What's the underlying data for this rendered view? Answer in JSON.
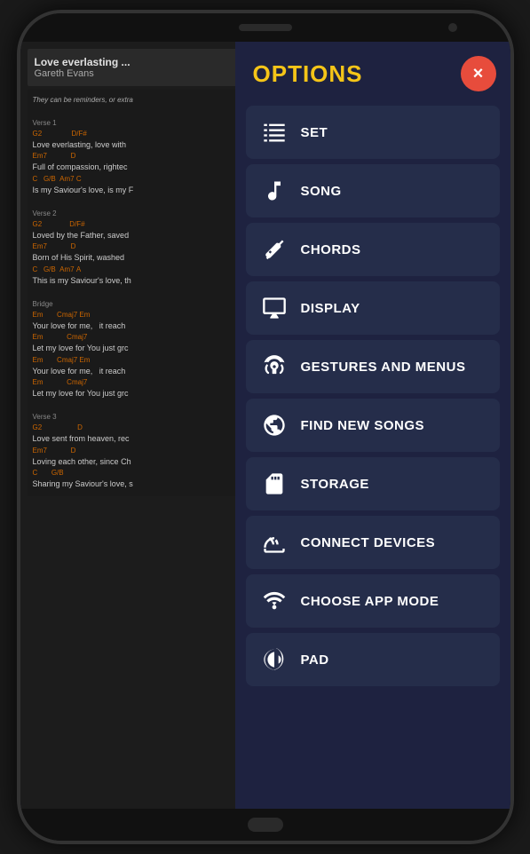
{
  "phone": {
    "screen": {
      "song": {
        "title": "Love everlasting ...",
        "artist": "Gareth Evans",
        "note": "They can be reminders, or extra",
        "sections": [
          {
            "label": "Verse 1",
            "lines": [
              {
                "chords": "G2                D/F#",
                "text": "Love everlasting, love with"
              },
              {
                "chords": "Em7               D",
                "text": "Full of compassion, rightec"
              },
              {
                "chords": "C    G/B    Am7  C",
                "text": "Is my Saviour's love, is my F"
              }
            ]
          },
          {
            "label": "Verse 2",
            "lines": [
              {
                "chords": "G2                D/F#",
                "text": "Loved by the Father, saved"
              },
              {
                "chords": "Em7               D",
                "text": "Born of His Spirit, washed"
              },
              {
                "chords": "C    G/B    Am7  A",
                "text": "This is my Saviour's love, th"
              }
            ]
          },
          {
            "label": "Bridge",
            "lines": [
              {
                "chords": "Em         Cmaj7 Em",
                "text": "Your love for me,   it reach"
              },
              {
                "chords": "Em              Cmaj7",
                "text": "Let my love for You just grc"
              },
              {
                "chords": "Em         Cmaj7 Em",
                "text": "Your love for me,   it reach"
              },
              {
                "chords": "Em              Cmaj7",
                "text": "Let my love for You just grc"
              }
            ]
          },
          {
            "label": "Verse 3",
            "lines": [
              {
                "chords": "G2                    D",
                "text": "Love sent from heaven, rec"
              },
              {
                "chords": "Em7               D",
                "text": "Loving each other, since Ch"
              },
              {
                "chords": "C       G/B",
                "text": "Sharing my Saviour's love, s"
              }
            ]
          }
        ]
      }
    },
    "options": {
      "title": "OPTIONS",
      "close_label": "×",
      "menu_items": [
        {
          "id": "set",
          "label": "SET",
          "icon": "list-icon"
        },
        {
          "id": "song",
          "label": "SONG",
          "icon": "music-note-icon"
        },
        {
          "id": "chords",
          "label": "CHORDS",
          "icon": "guitar-icon"
        },
        {
          "id": "display",
          "label": "DISPLAY",
          "icon": "monitor-icon"
        },
        {
          "id": "gestures",
          "label": "GESTURES AND MENUS",
          "icon": "fingerprint-icon"
        },
        {
          "id": "find-new-songs",
          "label": "FIND NEW SONGS",
          "icon": "globe-icon"
        },
        {
          "id": "storage",
          "label": "STORAGE",
          "icon": "sd-card-icon"
        },
        {
          "id": "connect-devices",
          "label": "CONNECT DEVICES",
          "icon": "cast-icon"
        },
        {
          "id": "choose-app-mode",
          "label": "CHOOSE APP MODE",
          "icon": "wifi-icon"
        },
        {
          "id": "pad",
          "label": "PAD",
          "icon": "speaker-icon"
        }
      ]
    }
  },
  "colors": {
    "accent_yellow": "#f5c518",
    "close_red": "#e74c3c",
    "menu_bg": "#252d4a",
    "panel_bg": "#1e2240",
    "chord_color": "#cc6600"
  }
}
